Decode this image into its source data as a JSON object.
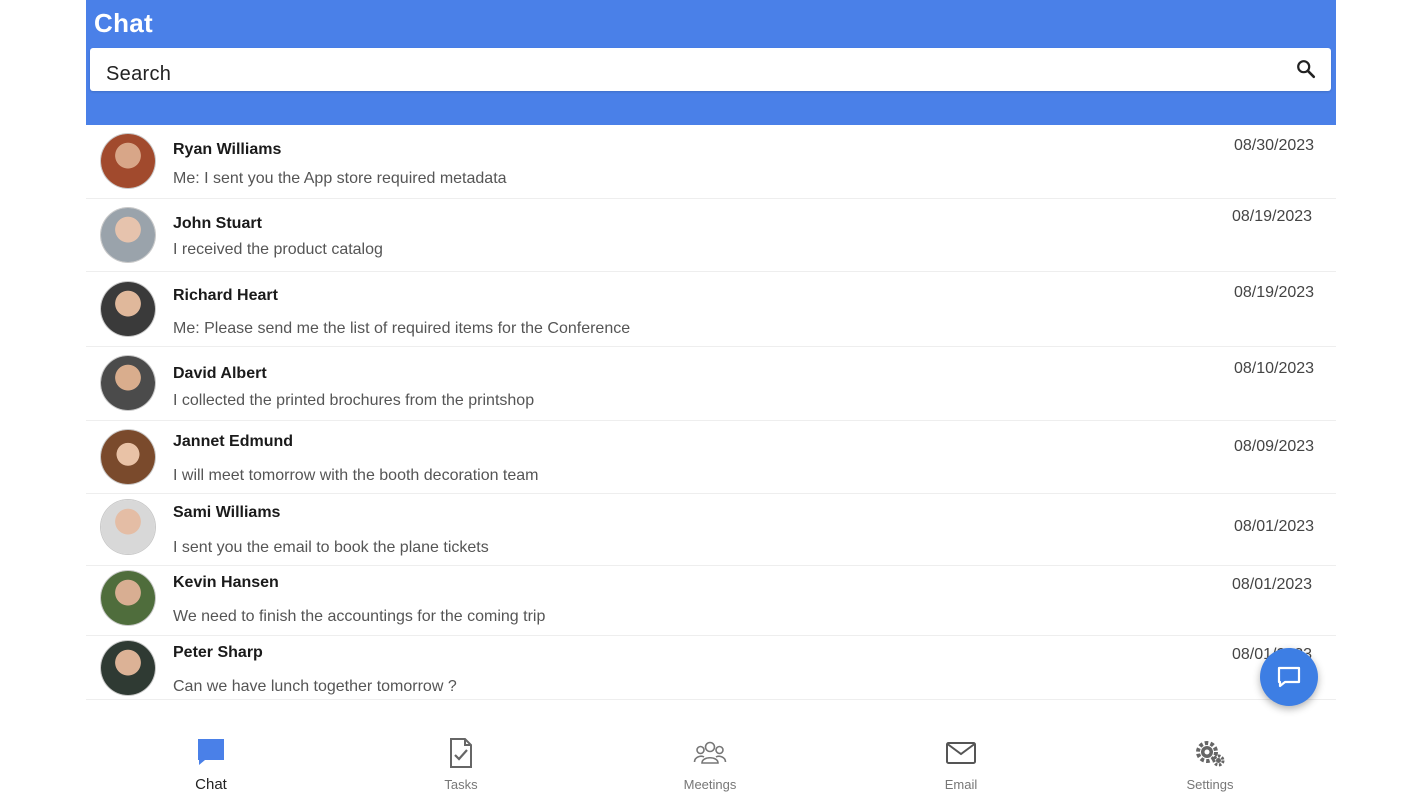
{
  "header": {
    "title": "Chat",
    "search_placeholder": "Search"
  },
  "chats": [
    {
      "name": "Ryan Williams",
      "message": "Me: I sent you the App store required metadata",
      "date": "08/30/2023"
    },
    {
      "name": "John Stuart",
      "message": "I received the product catalog",
      "date": "08/19/2023"
    },
    {
      "name": "Richard Heart",
      "message": "Me: Please send me the list of required items for the Conference",
      "date": "08/19/2023"
    },
    {
      "name": "David Albert",
      "message": "I collected the printed brochures from the printshop",
      "date": "08/10/2023"
    },
    {
      "name": "Jannet Edmund",
      "message": "I will meet tomorrow with the booth decoration team",
      "date": "08/09/2023"
    },
    {
      "name": "Sami Williams",
      "message": "I sent you the email to book the plane tickets",
      "date": "08/01/2023"
    },
    {
      "name": "Kevin Hansen",
      "message": "We need to finish the accountings for the coming trip",
      "date": "08/01/2023"
    },
    {
      "name": "Peter Sharp",
      "message": "Can we have lunch together tomorrow ?",
      "date": "08/01/2023"
    }
  ],
  "nav": [
    {
      "label": "Chat",
      "icon": "chat-icon",
      "active": true
    },
    {
      "label": "Tasks",
      "icon": "tasks-icon",
      "active": false
    },
    {
      "label": "Meetings",
      "icon": "meetings-icon",
      "active": false
    },
    {
      "label": "Email",
      "icon": "email-icon",
      "active": false
    },
    {
      "label": "Settings",
      "icon": "settings-icon",
      "active": false
    }
  ],
  "colors": {
    "accent": "#4a80e8",
    "fab": "#3d7ee4"
  }
}
